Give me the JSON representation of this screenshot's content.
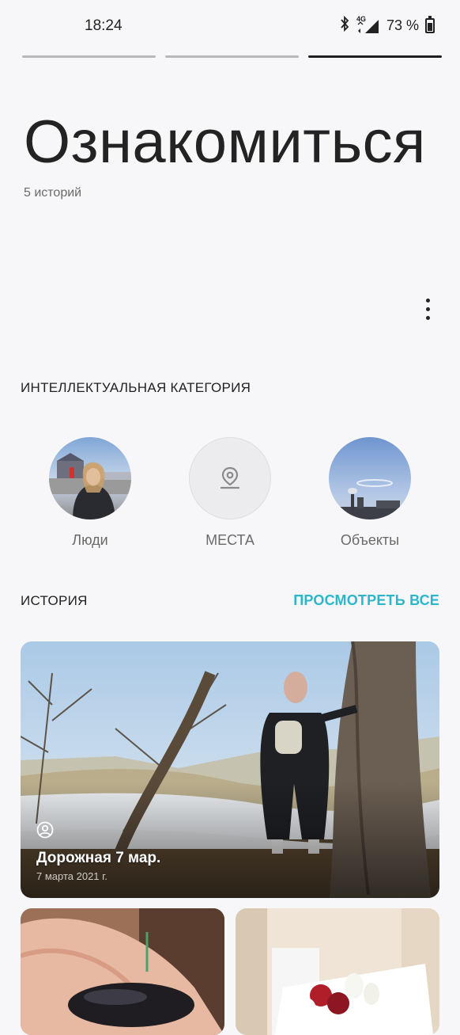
{
  "status_bar": {
    "time": "18:24",
    "network": "4G",
    "battery": "73 %"
  },
  "header": {
    "title": "Ознакомиться",
    "subtitle": "5 историй"
  },
  "smart_category": {
    "heading": "ИНТЕЛЛЕКТУАЛЬНАЯ КАТЕГОРИЯ",
    "items": [
      {
        "label": "Люди",
        "icon": "people-thumbnail"
      },
      {
        "label": "МЕСТА",
        "icon": "location-pin-icon"
      },
      {
        "label": "Объекты",
        "icon": "objects-thumbnail"
      }
    ]
  },
  "history": {
    "heading": "ИСТОРИЯ",
    "view_all": "ПРОСМОТРЕТЬ ВСЕ",
    "featured": {
      "title": "Дорожная 7 мар.",
      "date": "7 марта 2021 г.",
      "icon": "person-icon"
    }
  },
  "colors": {
    "accent": "#2bb7c9",
    "background": "#f7f7f9"
  }
}
